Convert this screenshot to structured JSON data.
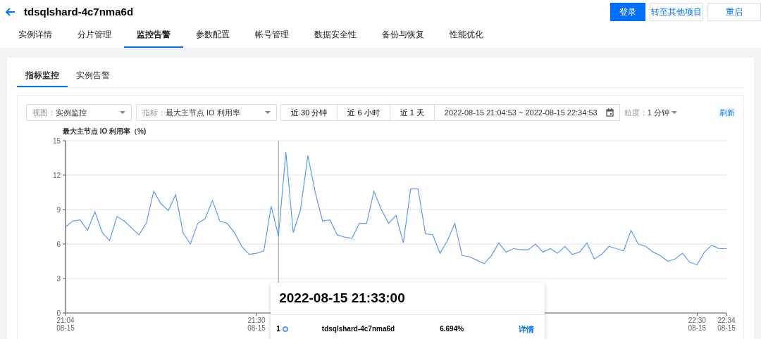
{
  "header": {
    "title": "tdsqlshard-4c7nma6d",
    "buttons": [
      {
        "label": "登录",
        "kind": "primary"
      },
      {
        "label": "转至其他项目",
        "kind": "outline"
      },
      {
        "label": "重启",
        "kind": "outline"
      }
    ]
  },
  "tabs": [
    {
      "label": "实例详情",
      "selected": false
    },
    {
      "label": "分片管理",
      "selected": false
    },
    {
      "label": "监控告警",
      "selected": true
    },
    {
      "label": "参数配置",
      "selected": false
    },
    {
      "label": "帐号管理",
      "selected": false
    },
    {
      "label": "数据安全性",
      "selected": false
    },
    {
      "label": "备份与恢复",
      "selected": false
    },
    {
      "label": "性能优化",
      "selected": false
    }
  ],
  "subtabs": [
    {
      "label": "指标监控",
      "selected": true
    },
    {
      "label": "实例告警",
      "selected": false
    }
  ],
  "toolbar": {
    "view": {
      "label": "视图：",
      "value": "实例监控"
    },
    "metric": {
      "label": "指标：",
      "value": "最大主节点 IO 利用率"
    },
    "ranges": [
      {
        "label": "近 30 分钟",
        "selected": false
      },
      {
        "label": "近 6 小时",
        "selected": false
      },
      {
        "label": "近 1 天",
        "selected": false
      }
    ],
    "date_range": "2022-08-15 21:04:53 ~ 2022-08-15 22:34:53",
    "granularity": {
      "label": "粒度：",
      "value": "1 分钟"
    },
    "refresh": "刷新"
  },
  "chart": {
    "chart_data": {
      "type": "line",
      "title": "最大主节点 IO 利用率（%)",
      "categories": [
        "21:04 08-15",
        null,
        null,
        null,
        null,
        null,
        null,
        null,
        null,
        null,
        null,
        null,
        null,
        null,
        null,
        null,
        null,
        null,
        null,
        null,
        null,
        null,
        null,
        null,
        null,
        null,
        "21:30 08-15",
        null,
        null,
        null,
        null,
        null,
        null,
        null,
        null,
        null,
        null,
        null,
        null,
        null,
        null,
        null,
        null,
        null,
        null,
        null,
        null,
        null,
        null,
        null,
        null,
        null,
        null,
        null,
        null,
        null,
        null,
        null,
        null,
        null,
        null,
        null,
        null,
        null,
        null,
        null,
        null,
        null,
        null,
        null,
        null,
        null,
        null,
        null,
        null,
        null,
        null,
        null,
        null,
        null,
        null,
        null,
        null,
        null,
        null,
        null,
        "22:30 08-15",
        null,
        null,
        null,
        "22:34 08-15"
      ],
      "series": [
        {
          "name": "tdsqlshard-4c7nma6d",
          "color": "#5b9bf8",
          "values": [
            7.5,
            8.0,
            8.1,
            7.2,
            8.8,
            7.0,
            6.3,
            8.4,
            8.0,
            7.4,
            6.8,
            7.8,
            10.6,
            9.5,
            8.9,
            10.3,
            7.0,
            6.0,
            7.8,
            8.2,
            9.8,
            8.0,
            7.8,
            7.0,
            5.8,
            5.1,
            5.2,
            5.4,
            9.3,
            6.7,
            14.0,
            7.0,
            9.0,
            13.7,
            10.5,
            8.0,
            8.1,
            6.8,
            6.6,
            6.5,
            7.8,
            7.8,
            10.6,
            9.0,
            7.8,
            8.5,
            6.1,
            10.8,
            10.8,
            6.9,
            6.8,
            5.2,
            6.3,
            7.8,
            5.0,
            4.9,
            4.6,
            4.3,
            5.0,
            6.1,
            5.3,
            5.6,
            5.5,
            5.5,
            6.0,
            5.3,
            5.6,
            5.2,
            5.8,
            5.1,
            5.3,
            6.1,
            4.7,
            5.1,
            5.8,
            5.6,
            5.4,
            7.2,
            6.0,
            5.8,
            5.3,
            5.0,
            4.5,
            4.7,
            5.2,
            4.4,
            4.2,
            5.3,
            5.9,
            5.6,
            5.6
          ]
        }
      ],
      "ylim": [
        0,
        15
      ],
      "yticks": [
        0,
        3,
        6,
        9,
        12,
        15
      ],
      "grid": true
    },
    "tooltip": {
      "title": "2022-08-15 21:33:00",
      "rows": [
        {
          "index": "1",
          "value": "6.694%",
          "link": "详情"
        }
      ]
    }
  }
}
